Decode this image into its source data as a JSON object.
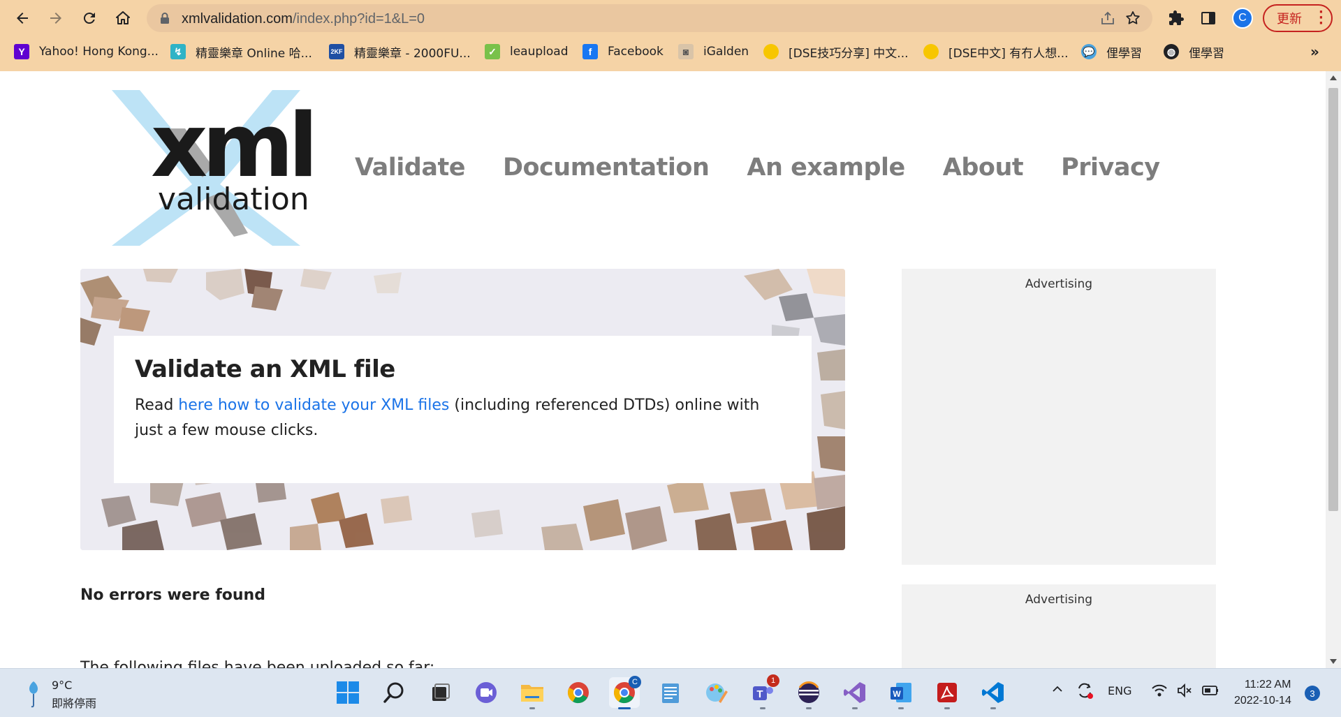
{
  "browser": {
    "url_host": "xmlvalidation.com",
    "url_path": "/index.php?id=1&L=0",
    "profile_initial": "C",
    "update_label": "更新",
    "bookmarks": [
      {
        "label": "Yahoo! Hong Kong...",
        "icon": "yahoo-icon"
      },
      {
        "label": "精靈樂章 Online 哈...",
        "icon": "game-icon"
      },
      {
        "label": "精靈樂章 - 2000FU...",
        "icon": "2kf-icon"
      },
      {
        "label": "leaupload",
        "icon": "chat-icon"
      },
      {
        "label": "Facebook",
        "icon": "facebook-icon"
      },
      {
        "label": "iGalden",
        "icon": "igalden-icon"
      },
      {
        "label": "[DSE技巧分享] 中文...",
        "icon": "forum-icon"
      },
      {
        "label": "[DSE中文] 有冇人想...",
        "icon": "forum-icon"
      },
      {
        "label": "俚學習",
        "icon": "bubble-icon"
      },
      {
        "label": "俚學習",
        "icon": "globe-icon"
      }
    ],
    "more_bookmarks": "»"
  },
  "site": {
    "logo_xml": "xml",
    "logo_validation": "validation",
    "nav": [
      "Validate",
      "Documentation",
      "An example",
      "About",
      "Privacy"
    ]
  },
  "hero": {
    "title": "Validate an XML file",
    "text_before": "Read ",
    "link": "here how to validate your XML files",
    "text_after": " (including referenced DTDs) online with just a few mouse clicks."
  },
  "ads": [
    "Advertising",
    "Advertising"
  ],
  "result": "No errors were found",
  "cutoff_text": "The following files have been uploaded so far:",
  "taskbar": {
    "weather_temp": "9°C",
    "weather_desc": "即將停雨",
    "language": "ENG",
    "time": "11:22 AM",
    "date": "2022-10-14",
    "notifications": "3",
    "teams_badge": "1",
    "chrome_badge": "C"
  },
  "colors": {
    "chrome_bg": "#f5d3a6",
    "link": "#1a73e8",
    "nav_text": "#7d7d7d",
    "ad_bg": "#f2f2f2"
  }
}
